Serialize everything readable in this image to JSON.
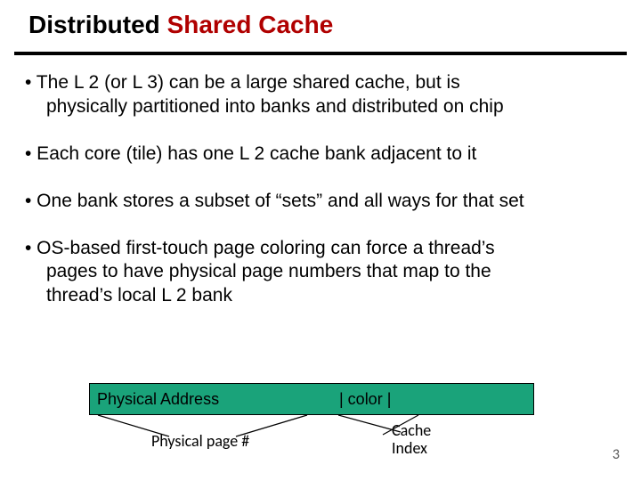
{
  "title": {
    "plain": "Distributed ",
    "accent": "Shared Cache"
  },
  "bullets": [
    "• The L 2 (or L 3) can be a large shared cache, but is",
    "physically partitioned into banks and distributed on chip",
    "• Each core (tile) has one L 2 cache bank adjacent to it",
    "• One bank stores a subset of “sets” and all ways for that set",
    "• OS-based first-touch page coloring can force a thread’s",
    "pages to have physical page numbers that map to the",
    "thread’s local L 2 bank"
  ],
  "diagram": {
    "bar_left": "Physical Address",
    "bar_right": "| color |",
    "anno_left": "Physical page #",
    "anno_right_l1": "Cache",
    "anno_right_l2": "Index"
  },
  "page_number": "3"
}
